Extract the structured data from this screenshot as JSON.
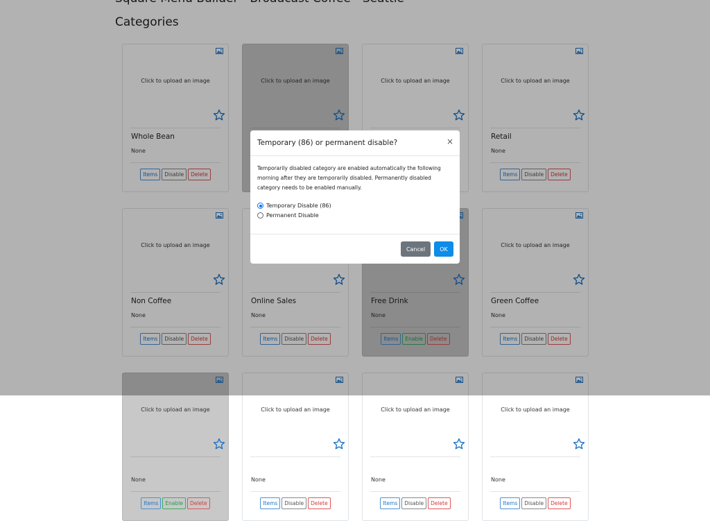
{
  "header": {
    "app_title": "Square Menu Builder - Broadcast Coffee - Seattle",
    "section_title": "Categories"
  },
  "card_common": {
    "upload_text": "Click to upload an image",
    "status": "None",
    "items_label": "Items",
    "disable_label": "Disable",
    "enable_label": "Enable",
    "delete_label": "Delete"
  },
  "cards": [
    {
      "name": "Whole Bean",
      "disabled": false
    },
    {
      "name": "",
      "disabled": true
    },
    {
      "name": "",
      "disabled": false
    },
    {
      "name": "Retail",
      "disabled": false
    },
    {
      "name": "Non Coffee",
      "disabled": false
    },
    {
      "name": "Online Sales",
      "disabled": false
    },
    {
      "name": "Free Drink",
      "disabled": true
    },
    {
      "name": "Green Coffee",
      "disabled": false
    },
    {
      "name": "",
      "disabled": true
    },
    {
      "name": "",
      "disabled": false
    },
    {
      "name": "",
      "disabled": false
    },
    {
      "name": "",
      "disabled": false
    }
  ],
  "modal": {
    "title": "Temporary (86) or permanent disable?",
    "close_symbol": "×",
    "body": "Temporarily disabled category are enabled automatically the following morning after they are temporarily disabled. Permanently disabled category needs to be enabled manually.",
    "options": [
      {
        "label": "Temporary Disable (86)",
        "checked": true
      },
      {
        "label": "Permanent Disable",
        "checked": false
      }
    ],
    "cancel_label": "Cancel",
    "ok_label": "OK"
  },
  "icons": {
    "image": "image-icon",
    "favorite": "star-outline-icon",
    "close": "close-icon"
  },
  "colors": {
    "accent": "#0d8ce8",
    "star": "#1a73c9",
    "delete": "#d43b3b",
    "enable": "#1f9d4a",
    "cancel": "#6c757d"
  }
}
